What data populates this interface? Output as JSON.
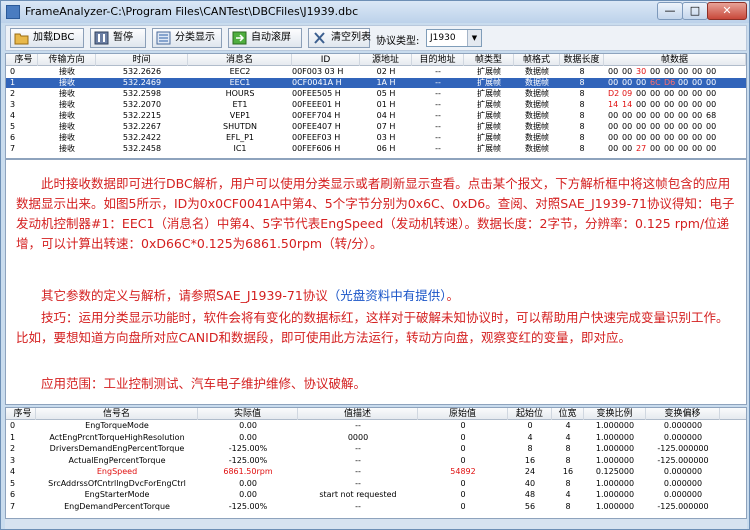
{
  "window": {
    "title": "FrameAnalyzer-C:\\Program Files\\CANTest\\DBCFiles\\J1939.dbc",
    "min": "—",
    "max": "□",
    "close": "✕"
  },
  "toolbar": {
    "load": "加载DBC",
    "pause": "暂停",
    "classify": "分类显示",
    "autoscroll": "自动滚屏",
    "clear": "清空列表",
    "protocol_label": "协议类型:",
    "protocol_value": "J1930"
  },
  "frames": {
    "columns": [
      "序号",
      "传输方向",
      "时间",
      "消息名",
      "ID",
      "源地址",
      "目的地址",
      "帧类型",
      "帧格式",
      "数据长度",
      "帧数据"
    ],
    "rows": [
      {
        "idx": "0",
        "dir": "接收",
        "time": "532.2626",
        "name": "EEC2",
        "id": "00F003 03 H",
        "src": "02 H",
        "dst": "--",
        "type": "扩展帧",
        "fmt": "数据帧",
        "len": "8",
        "data": [
          [
            "00",
            0
          ],
          [
            "00",
            0
          ],
          [
            "30",
            1
          ],
          [
            "00",
            0
          ],
          [
            "00",
            0
          ],
          [
            "00",
            0
          ],
          [
            "00",
            0
          ],
          [
            "00",
            0
          ]
        ]
      },
      {
        "idx": "1",
        "dir": "接收",
        "time": "532.2469",
        "name": "EEC1",
        "id": "0CF0041A H",
        "src": "1A H",
        "dst": "--",
        "type": "扩展帧",
        "fmt": "数据帧",
        "len": "8",
        "data": [
          [
            "00",
            0
          ],
          [
            "00",
            0
          ],
          [
            "00",
            0
          ],
          [
            "6C",
            1
          ],
          [
            "D6",
            1
          ],
          [
            "00",
            0
          ],
          [
            "00",
            0
          ],
          [
            "00",
            0
          ]
        ]
      },
      {
        "idx": "2",
        "dir": "接收",
        "time": "532.2598",
        "name": "HOURS",
        "id": "00FEE505 H",
        "src": "05 H",
        "dst": "--",
        "type": "扩展帧",
        "fmt": "数据帧",
        "len": "8",
        "data": [
          [
            "D2",
            1
          ],
          [
            "09",
            1
          ],
          [
            "00",
            0
          ],
          [
            "00",
            0
          ],
          [
            "00",
            0
          ],
          [
            "00",
            0
          ],
          [
            "00",
            0
          ],
          [
            "00",
            0
          ]
        ]
      },
      {
        "idx": "3",
        "dir": "接收",
        "time": "532.2070",
        "name": "ET1",
        "id": "00FEEE01 H",
        "src": "01 H",
        "dst": "--",
        "type": "扩展帧",
        "fmt": "数据帧",
        "len": "8",
        "data": [
          [
            "14",
            1
          ],
          [
            "14",
            1
          ],
          [
            "00",
            0
          ],
          [
            "00",
            0
          ],
          [
            "00",
            0
          ],
          [
            "00",
            0
          ],
          [
            "00",
            0
          ],
          [
            "00",
            0
          ]
        ]
      },
      {
        "idx": "4",
        "dir": "接收",
        "time": "532.2215",
        "name": "VEP1",
        "id": "00FEF704 H",
        "src": "04 H",
        "dst": "--",
        "type": "扩展帧",
        "fmt": "数据帧",
        "len": "8",
        "data": [
          [
            "00",
            0
          ],
          [
            "00",
            0
          ],
          [
            "00",
            0
          ],
          [
            "00",
            0
          ],
          [
            "00",
            0
          ],
          [
            "00",
            0
          ],
          [
            "00",
            0
          ],
          [
            "68",
            0
          ]
        ]
      },
      {
        "idx": "5",
        "dir": "接收",
        "time": "532.2267",
        "name": "SHUTDN",
        "id": "00FEE407 H",
        "src": "07 H",
        "dst": "--",
        "type": "扩展帧",
        "fmt": "数据帧",
        "len": "8",
        "data": [
          [
            "00",
            0
          ],
          [
            "00",
            0
          ],
          [
            "00",
            0
          ],
          [
            "00",
            0
          ],
          [
            "00",
            0
          ],
          [
            "00",
            0
          ],
          [
            "00",
            0
          ],
          [
            "00",
            0
          ]
        ]
      },
      {
        "idx": "6",
        "dir": "接收",
        "time": "532.2422",
        "name": "EFL_P1",
        "id": "00FEEF03 H",
        "src": "03 H",
        "dst": "--",
        "type": "扩展帧",
        "fmt": "数据帧",
        "len": "8",
        "data": [
          [
            "00",
            0
          ],
          [
            "00",
            0
          ],
          [
            "00",
            0
          ],
          [
            "00",
            0
          ],
          [
            "00",
            0
          ],
          [
            "00",
            0
          ],
          [
            "00",
            0
          ],
          [
            "00",
            0
          ]
        ]
      },
      {
        "idx": "7",
        "dir": "接收",
        "time": "532.2458",
        "name": "IC1",
        "id": "00FEF606 H",
        "src": "06 H",
        "dst": "--",
        "type": "扩展帧",
        "fmt": "数据帧",
        "len": "8",
        "data": [
          [
            "00",
            0
          ],
          [
            "00",
            0
          ],
          [
            "27",
            1
          ],
          [
            "00",
            0
          ],
          [
            "00",
            0
          ],
          [
            "00",
            0
          ],
          [
            "00",
            0
          ],
          [
            "00",
            0
          ]
        ]
      }
    ],
    "selected_row": 1
  },
  "article": {
    "p1": "此时接收数据即可进行DBC解析，用户可以使用分类显示或者刷新显示查看。点击某个报文，下方解析框中将这帧包含的应用数据显示出来。如图5所示，ID为0x0CF0041A中第4、5个字节分别为0x6C、0xD6。查阅、对照SAE_J1939-71协议得知：电子发动机控制器#1：EEC1（消息名）中第4、5字节代表EngSpeed（发动机转速）。数据长度：2字节，分辨率：0.125 rpm/位递增，可以计算出转速：0xD66C*0.125为6861.50rpm（转/分）。",
    "p2_main": "其它参数的定义与解析，请参照SAE_J1939-71协议",
    "p2_note": "（光盘资料中有提供）",
    "p2_end": "。",
    "p3": "技巧：运用分类显示功能时，软件会将有变化的数据标红，这样对于破解未知协议时，可以帮助用户快速完成变量识别工作。比如，要想知道方向盘所对应CANID和数据段，即可使用此方法运行，转动方向盘，观察变红的变量，即对应。",
    "p4": "应用范围：工业控制测试、汽车电子维护维修、协议破解。"
  },
  "signals": {
    "columns": [
      "序号",
      "信号名",
      "实际值",
      "值描述",
      "原始值",
      "起始位",
      "位宽",
      "变换比例",
      "变换偏移"
    ],
    "rows": [
      {
        "idx": "0",
        "name": "EngTorqueMode",
        "actual": "0.00",
        "desc": "--",
        "raw": "0",
        "start": "0",
        "width": "4",
        "scale": "1.000000",
        "offset": "0.000000",
        "red": false
      },
      {
        "idx": "1",
        "name": "ActEngPrcntTorqueHighResolution",
        "actual": "0.00",
        "desc": "0000",
        "raw": "0",
        "start": "4",
        "width": "4",
        "scale": "1.000000",
        "offset": "0.000000",
        "red": false
      },
      {
        "idx": "2",
        "name": "DriversDemandEngPercentTorque",
        "actual": "-125.00%",
        "desc": "--",
        "raw": "0",
        "start": "8",
        "width": "8",
        "scale": "1.000000",
        "offset": "-125.000000",
        "red": false
      },
      {
        "idx": "3",
        "name": "ActualEngPercentTorque",
        "actual": "-125.00%",
        "desc": "--",
        "raw": "0",
        "start": "16",
        "width": "8",
        "scale": "1.000000",
        "offset": "-125.000000",
        "red": false
      },
      {
        "idx": "4",
        "name": "EngSpeed",
        "actual": "6861.50rpm",
        "desc": "--",
        "raw": "54892",
        "start": "24",
        "width": "16",
        "scale": "0.125000",
        "offset": "0.000000",
        "red": true
      },
      {
        "idx": "5",
        "name": "SrcAddrssOfCntrllngDvcForEngCtrl",
        "actual": "0.00",
        "desc": "--",
        "raw": "0",
        "start": "40",
        "width": "8",
        "scale": "1.000000",
        "offset": "0.000000",
        "red": false
      },
      {
        "idx": "6",
        "name": "EngStarterMode",
        "actual": "0.00",
        "desc": "start not requested",
        "raw": "0",
        "start": "48",
        "width": "4",
        "scale": "1.000000",
        "offset": "0.000000",
        "red": false
      },
      {
        "idx": "7",
        "name": "EngDemandPercentTorque",
        "actual": "-125.00%",
        "desc": "--",
        "raw": "0",
        "start": "56",
        "width": "8",
        "scale": "1.000000",
        "offset": "-125.000000",
        "red": false
      }
    ]
  }
}
